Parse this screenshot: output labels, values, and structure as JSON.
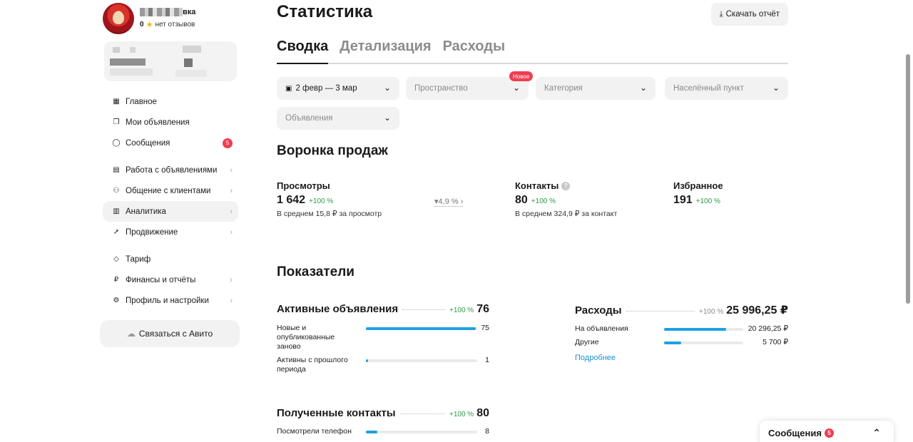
{
  "profile": {
    "name_suffix": "вка",
    "rating": "0",
    "reviews": "нет отзывов"
  },
  "sidebar": {
    "items": [
      {
        "label": "Главное",
        "icon": "grid-icon"
      },
      {
        "label": "Мои объявления",
        "icon": "copy-icon"
      },
      {
        "label": "Сообщения",
        "icon": "chat-icon",
        "badge": "5"
      },
      {
        "label": "Работа с объявлениями",
        "icon": "clipboard-icon"
      },
      {
        "label": "Общение с клиентами",
        "icon": "users-icon"
      },
      {
        "label": "Аналитика",
        "icon": "chart-icon"
      },
      {
        "label": "Продвижение",
        "icon": "rocket-icon"
      },
      {
        "label": "Тариф",
        "icon": "diamond-icon"
      },
      {
        "label": "Финансы и отчёты",
        "icon": "ruble-icon"
      },
      {
        "label": "Профиль и настройки",
        "icon": "settings-icon"
      }
    ],
    "contact_button": "Связаться с Авито"
  },
  "header": {
    "title": "Статистика",
    "download": "Скачать отчёт"
  },
  "tabs": [
    {
      "label": "Сводка",
      "active": true
    },
    {
      "label": "Детализация",
      "active": false
    },
    {
      "label": "Расходы",
      "active": false
    }
  ],
  "filters": {
    "date": "2 февр — 3 мар",
    "space": "Пространство",
    "new_badge": "Новое",
    "category": "Категория",
    "locality": "Населённый пункт",
    "ads": "Объявления"
  },
  "funnel": {
    "title": "Воронка продаж",
    "views": {
      "label": "Просмотры",
      "value": "1 642",
      "delta": "+100 %",
      "sub": "В среднем 15,8 ₽ за просмотр"
    },
    "conversion": "4,9 %",
    "contacts": {
      "label": "Контакты",
      "value": "80",
      "delta": "+100 %",
      "sub": "В среднем 324,9 ₽ за контакт"
    },
    "favorites": {
      "label": "Избранное",
      "value": "191",
      "delta": "+100 %"
    }
  },
  "indicators": {
    "title": "Показатели",
    "active_ads": {
      "title": "Активные объявления",
      "delta": "+100 %",
      "total": "76",
      "rows": [
        {
          "label": "Новые и опубликованные заново",
          "value": "75",
          "fraction": 0.987
        },
        {
          "label": "Активны с прошлого периода",
          "value": "1",
          "fraction": 0.013
        }
      ]
    },
    "expenses": {
      "title": "Расходы",
      "delta": "+100 %",
      "total": "25 996,25 ₽",
      "rows": [
        {
          "label": "На объявления",
          "value": "20 296,25 ₽",
          "fraction": 0.78
        },
        {
          "label": "Другие",
          "value": "5 700 ₽",
          "fraction": 0.22
        }
      ],
      "link": "Подробнее"
    },
    "contacts": {
      "title": "Полученные контакты",
      "delta": "+100 %",
      "total": "80",
      "rows": [
        {
          "label": "Посмотрели телефон",
          "value": "8",
          "fraction": 0.1
        }
      ]
    }
  },
  "messages_panel": {
    "label": "Сообщения",
    "badge": "5"
  },
  "colors": {
    "accent_blue": "#1da1e0",
    "positive_green": "#2c9b46",
    "badge_red": "#ef3d52"
  }
}
